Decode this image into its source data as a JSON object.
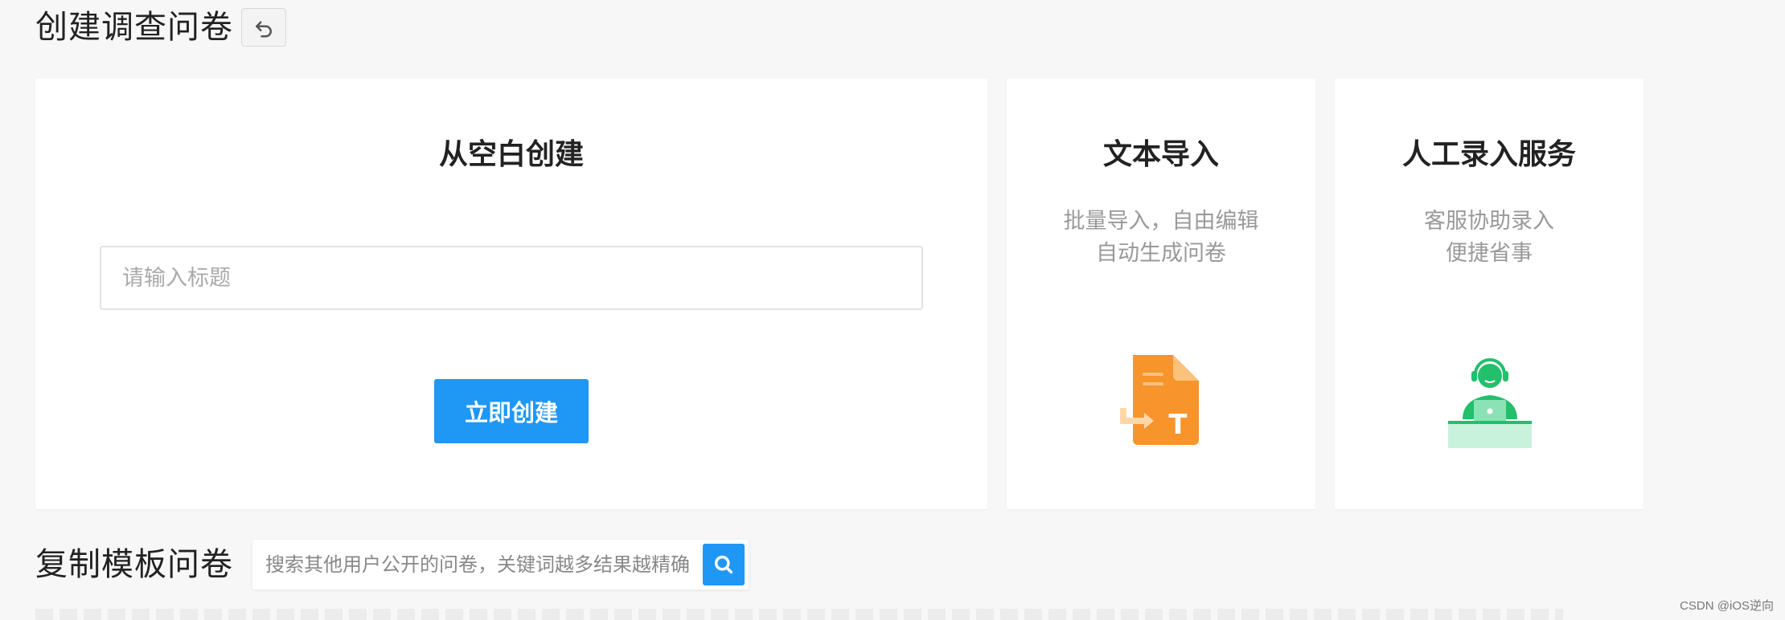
{
  "header": {
    "title": "创建调查问卷",
    "back_icon": "undo-arrow-icon"
  },
  "cards": {
    "blank": {
      "title": "从空白创建",
      "input_placeholder": "请输入标题",
      "input_value": "",
      "button_label": "立即创建"
    },
    "text_import": {
      "title": "文本导入",
      "desc_line1": "批量导入，自由编辑",
      "desc_line2": "自动生成问卷",
      "icon": "document-import-icon"
    },
    "manual": {
      "title": "人工录入服务",
      "desc_line1": "客服协助录入",
      "desc_line2": "便捷省事",
      "icon": "customer-service-agent-icon"
    }
  },
  "template": {
    "title": "复制模板问卷",
    "search_placeholder": "搜索其他用户公开的问卷，关键词越多结果越精确",
    "search_value": "",
    "search_icon": "search-icon"
  },
  "watermark": "CSDN @iOS逆向",
  "colors": {
    "accent": "#1f97f5",
    "orange": "#f7942b",
    "green": "#22c06b",
    "page_bg": "#f7f7f7"
  }
}
